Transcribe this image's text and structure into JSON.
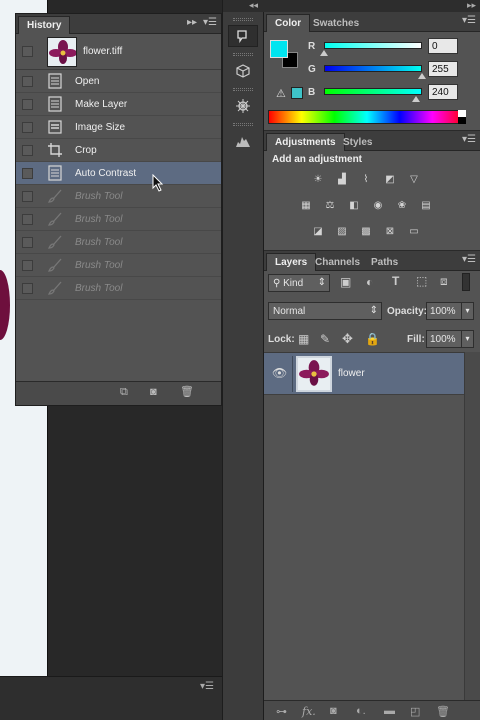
{
  "history": {
    "tab_label": "History",
    "snapshot_name": "flower.tiff",
    "items": [
      {
        "label": "Open",
        "icon": "document-icon",
        "disabled": false
      },
      {
        "label": "Make Layer",
        "icon": "document-icon",
        "disabled": false
      },
      {
        "label": "Image Size",
        "icon": "image-size-icon",
        "disabled": false
      },
      {
        "label": "Crop",
        "icon": "crop-icon",
        "disabled": false
      },
      {
        "label": "Auto Contrast",
        "icon": "document-icon",
        "disabled": false,
        "active": true
      },
      {
        "label": "Brush Tool",
        "icon": "brush-icon",
        "disabled": true
      },
      {
        "label": "Brush Tool",
        "icon": "brush-icon",
        "disabled": true
      },
      {
        "label": "Brush Tool",
        "icon": "brush-icon",
        "disabled": true
      },
      {
        "label": "Brush Tool",
        "icon": "brush-icon",
        "disabled": true
      },
      {
        "label": "Brush Tool",
        "icon": "brush-icon",
        "disabled": true
      }
    ]
  },
  "color": {
    "tabs": [
      "Color",
      "Swatches"
    ],
    "foreground": "#00e5f0",
    "background": "#000000",
    "r_label": "R",
    "r_value": "0",
    "g_label": "G",
    "g_value": "255",
    "b_label": "B",
    "b_value": "240",
    "r_level": 0.0,
    "g_level": 1.0,
    "b_level": 0.94
  },
  "adjustments": {
    "tabs": [
      "Adjustments",
      "Styles"
    ],
    "subtitle": "Add an adjustment"
  },
  "layers": {
    "tabs": [
      "Layers",
      "Channels",
      "Paths"
    ],
    "filter_kind": "Kind",
    "blend_mode": "Normal",
    "opacity_label": "Opacity:",
    "opacity_value": "100%",
    "lock_label": "Lock:",
    "fill_label": "Fill:",
    "fill_value": "100%",
    "layer_name": "flower"
  },
  "colors": {
    "active_row": "#5d6b82",
    "panel_bg": "#535353"
  }
}
